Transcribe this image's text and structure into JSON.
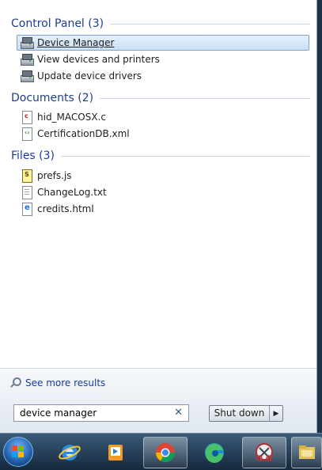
{
  "groups": [
    {
      "title": "Control Panel (3)",
      "items": [
        {
          "label": "Device Manager",
          "icon": "device-manager-icon",
          "selected": true
        },
        {
          "label": "View devices and printers",
          "icon": "devices-printers-icon",
          "selected": false
        },
        {
          "label": "Update device drivers",
          "icon": "update-drivers-icon",
          "selected": false
        }
      ]
    },
    {
      "title": "Documents (2)",
      "items": [
        {
          "label": "hid_MACOSX.c",
          "icon": "c-file-icon"
        },
        {
          "label": "CertificationDB.xml",
          "icon": "xml-file-icon"
        }
      ]
    },
    {
      "title": "Files (3)",
      "items": [
        {
          "label": "prefs.js",
          "icon": "js-file-icon"
        },
        {
          "label": "ChangeLog.txt",
          "icon": "txt-file-icon"
        },
        {
          "label": "credits.html",
          "icon": "html-file-icon"
        }
      ]
    }
  ],
  "see_more": {
    "label": "See more results",
    "icon": "search-icon"
  },
  "search": {
    "value": "device manager",
    "clear_icon": "clear-icon"
  },
  "shutdown": {
    "label": "Shut down",
    "arrow_icon": "arrow-right-icon"
  },
  "taskbar": {
    "items": [
      "start-button",
      "internet-explorer-icon",
      "media-player-icon",
      "chrome-icon",
      "edge-icon",
      "snipping-tool-icon",
      "file-explorer-icon"
    ],
    "active": [
      "chrome-icon",
      "snipping-tool-icon",
      "file-explorer-icon"
    ]
  },
  "colors": {
    "header": "#1e3d8f",
    "link": "#1a3f8f",
    "selection_border": "#7da2ce"
  }
}
